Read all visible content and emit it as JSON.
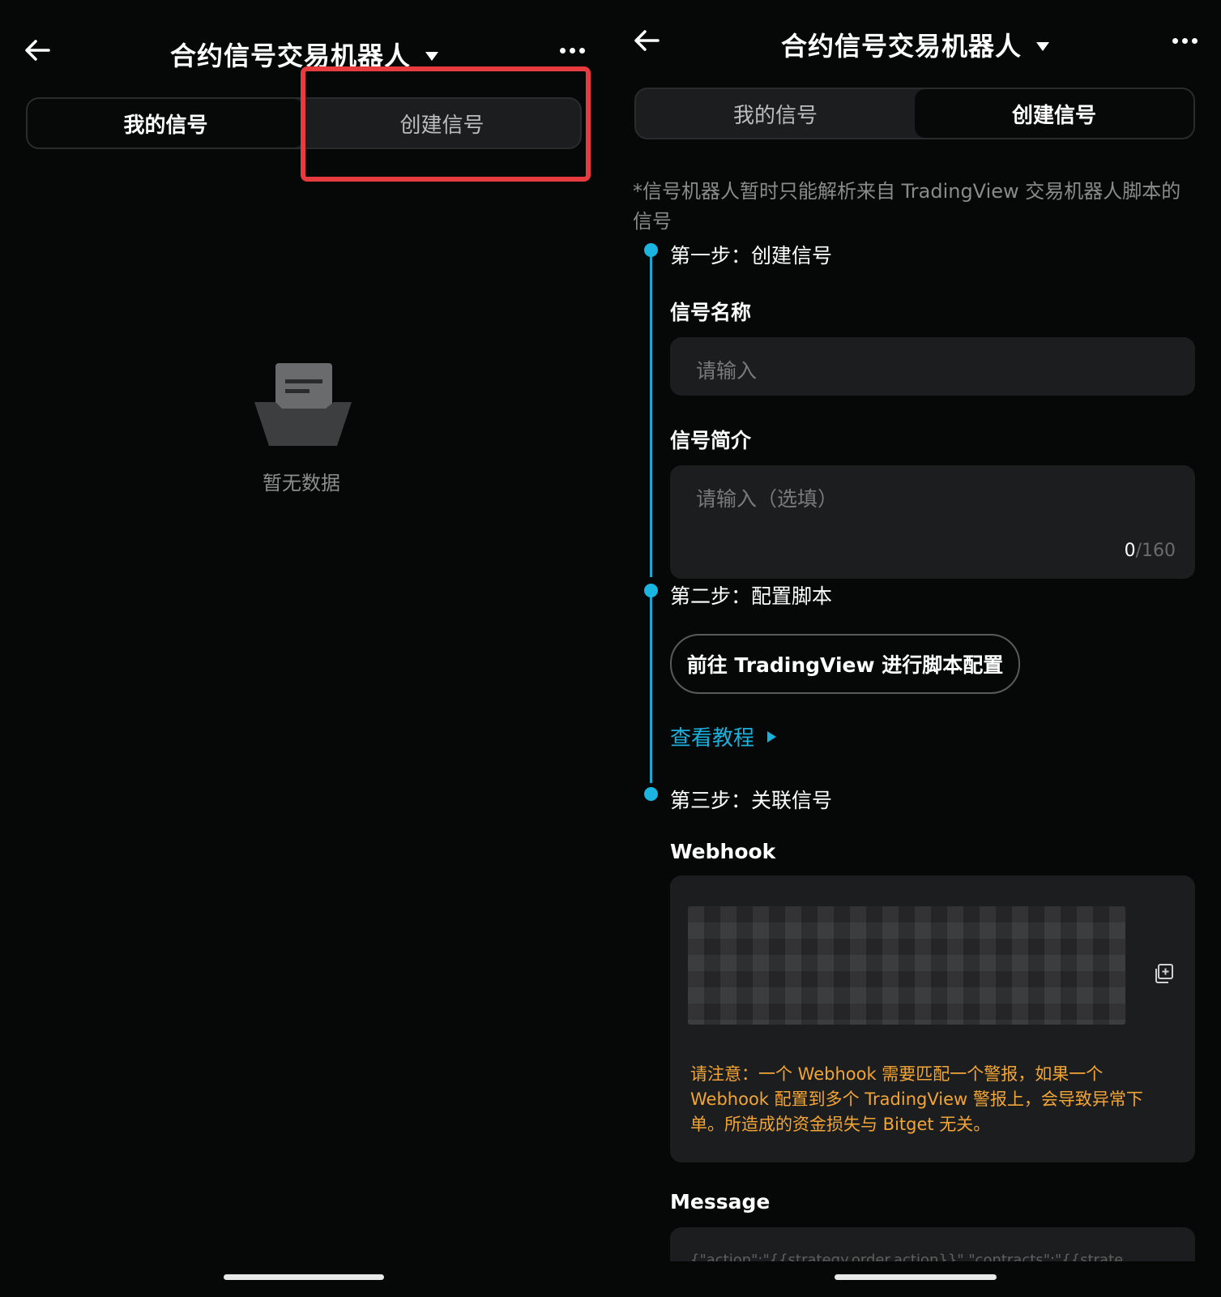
{
  "colors": {
    "background": "#060707",
    "surface": "#1c1d1f",
    "accent": "#1ab5e0",
    "warning": "#f2a535",
    "highlight": "#e63b3f"
  },
  "left": {
    "header": {
      "back_icon": "arrow-left-icon",
      "title": "合约信号交易机器人",
      "dropdown_icon": "caret-down-icon",
      "more_icon": "more-horizontal-icon"
    },
    "tabs": [
      "我的信号",
      "创建信号"
    ],
    "active_tab": "我的信号",
    "empty_state": {
      "icon": "empty-folder-icon",
      "label": "暂无数据"
    }
  },
  "right": {
    "header": {
      "back_icon": "arrow-left-icon",
      "title": "合约信号交易机器人",
      "dropdown_icon": "caret-down-icon",
      "more_icon": "more-horizontal-icon"
    },
    "tabs": [
      "我的信号",
      "创建信号"
    ],
    "active_tab": "创建信号",
    "note": "*信号机器人暂时只能解析来自 TradingView 交易机器人脚本的信号",
    "step1": {
      "title": "第一步：创建信号",
      "name_label": "信号名称",
      "name_placeholder": "请输入",
      "intro_label": "信号简介",
      "intro_placeholder": "请输入（选填）",
      "counter_current": "0",
      "counter_max": "/160"
    },
    "step2": {
      "title": "第二步：配置脚本",
      "button_label": "前往 TradingView 进行脚本配置",
      "tutorial_link": "查看教程"
    },
    "step3": {
      "title": "第三步：关联信号",
      "webhook_label": "Webhook",
      "copy_icon": "copy-icon",
      "warning": "请注意：一个 Webhook 需要匹配一个警报，如果一个 Webhook 配置到多个 TradingView 警报上，会导致异常下单。所造成的资金损失与 Bitget 无关。",
      "message_label": "Message",
      "message_preview": "{\"action\":\"{{strategy.order.action}}\",\"contracts\":\"{{strate"
    }
  }
}
